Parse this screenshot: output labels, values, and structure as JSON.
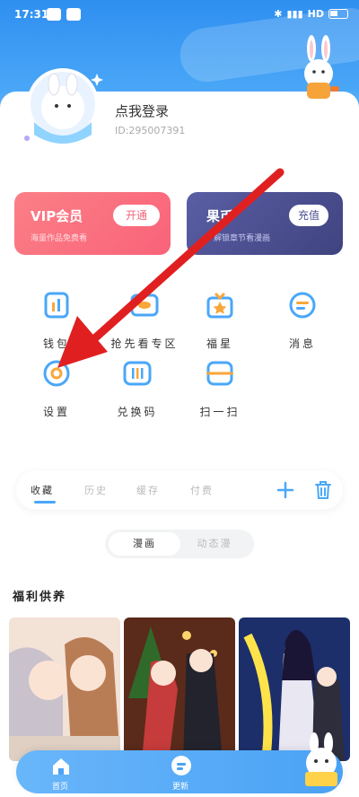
{
  "status": {
    "time": "17:31",
    "net": "HD"
  },
  "user": {
    "name": "点我登录",
    "id": "ID:295007391"
  },
  "vip_card": {
    "title": "VIP会员",
    "subtitle": "海量作品免费看",
    "button": "开通"
  },
  "coin_card": {
    "title": "果币",
    "subtitle": "解锁章节看漫画",
    "button": "充值"
  },
  "grid": [
    {
      "label": "钱包",
      "icon": "wallet-icon"
    },
    {
      "label": "抢先看专区",
      "icon": "preview-icon"
    },
    {
      "label": "福星",
      "icon": "gift-star-icon"
    },
    {
      "label": "消息",
      "icon": "message-icon"
    },
    {
      "label": "设置",
      "icon": "settings-icon"
    },
    {
      "label": "兑换码",
      "icon": "barcode-icon"
    },
    {
      "label": "扫一扫",
      "icon": "scan-icon"
    }
  ],
  "tabs": [
    "收藏",
    "历史",
    "缓存",
    "付费"
  ],
  "segment": {
    "on": "漫画",
    "off": "动态漫"
  },
  "section_title": "福利供养",
  "navbar": {
    "home": "首页",
    "mine": "更新"
  },
  "colors": {
    "primary": "#4aa7f8",
    "vip": "#f9637a",
    "coin": "#4a4f93",
    "arrow": "#e02020"
  }
}
